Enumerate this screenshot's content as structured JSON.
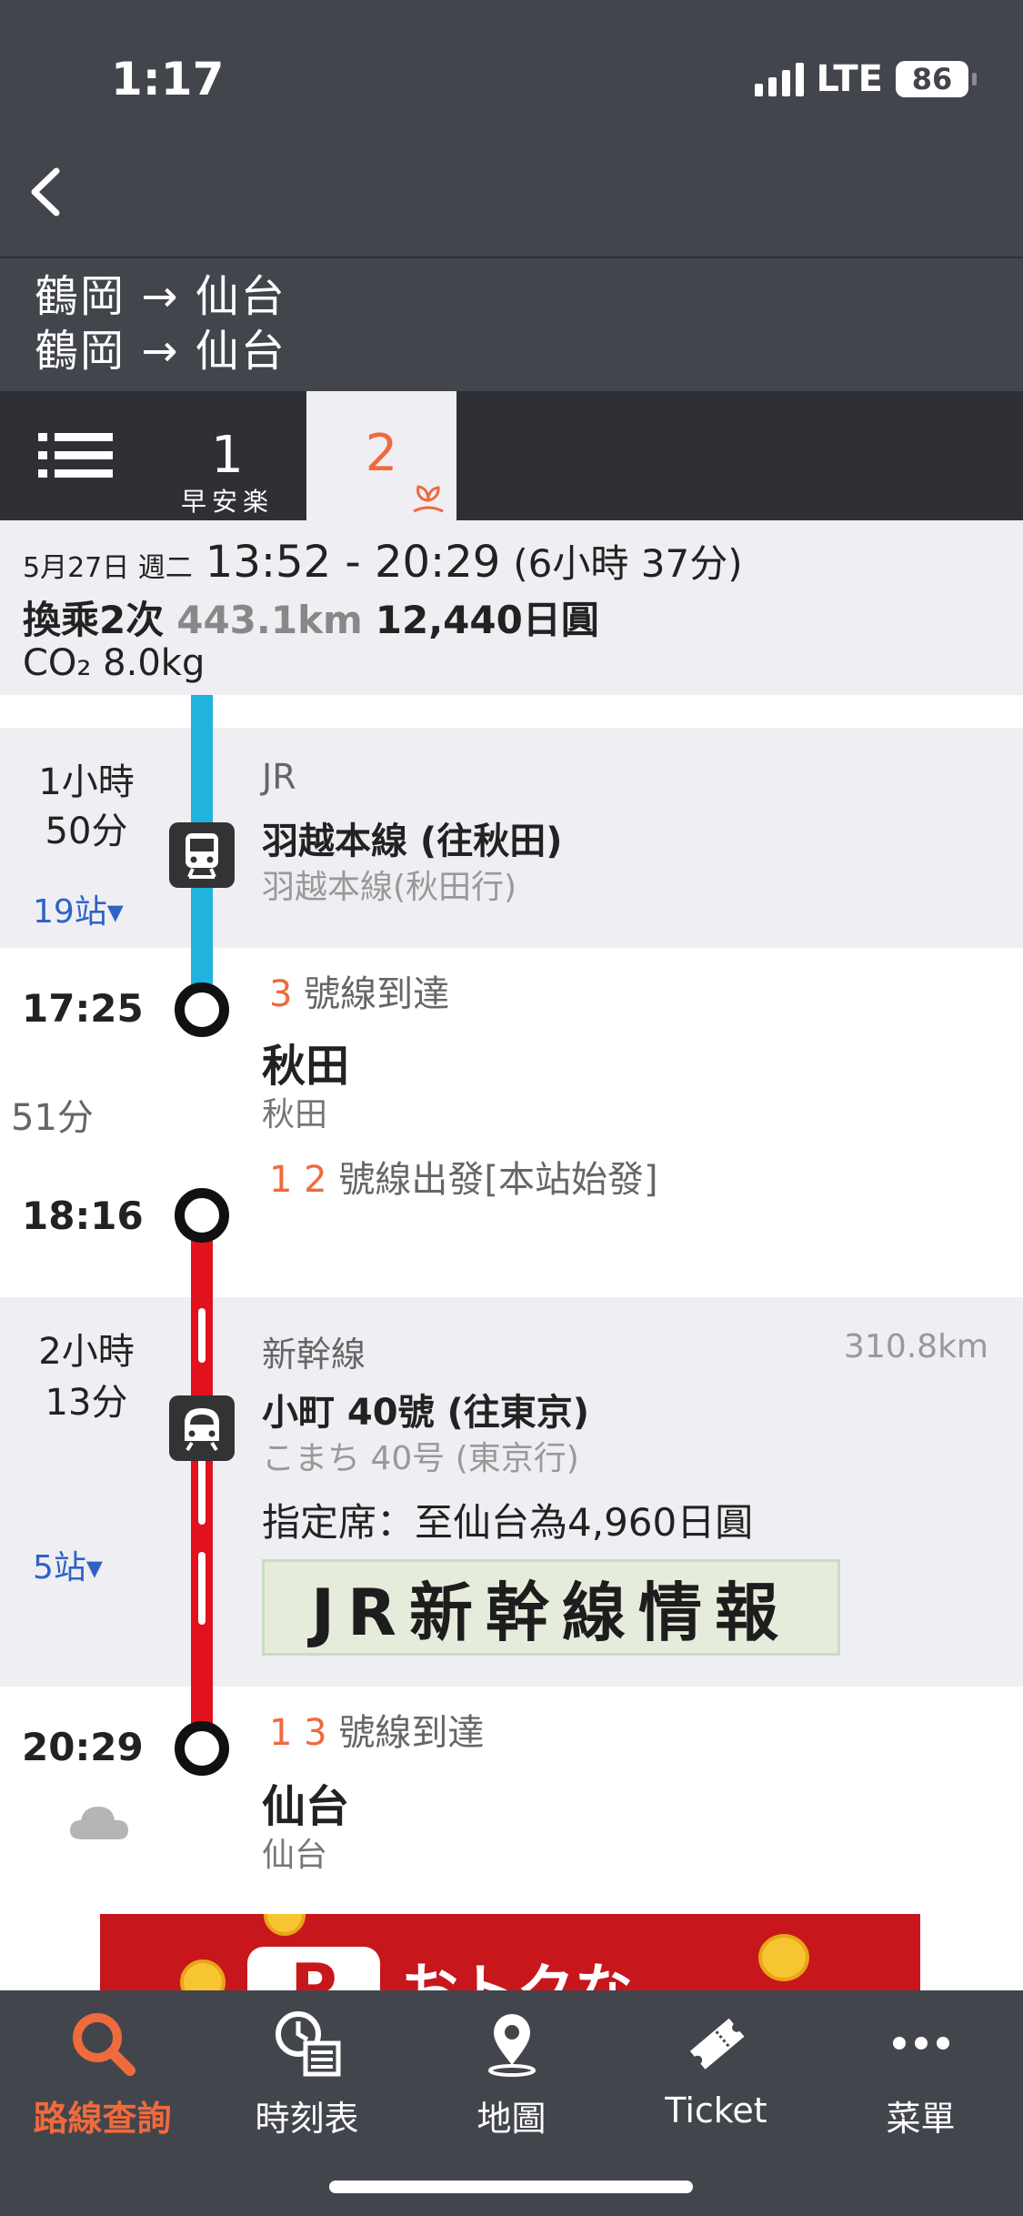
{
  "status": {
    "time": "1:17",
    "network": "LTE",
    "battery": "86"
  },
  "route": {
    "line1": "鶴岡 → 仙台",
    "line2": "鶴岡 → 仙台"
  },
  "tabs": [
    {
      "num": "1",
      "sub": "早安楽"
    },
    {
      "num": "2",
      "sub": ""
    }
  ],
  "summary": {
    "date": "5月27日 週二",
    "time": "13:52 - 20:29",
    "duration": "(6小時 37分)",
    "transfers": "換乘2次",
    "distance": "443.1km",
    "fare": "12,440日圓",
    "co2": "CO₂ 8.0kg"
  },
  "segment1": {
    "duration1": "1小時",
    "duration2": "50分",
    "stops": "19站▾",
    "company": "JR",
    "title": "羽越本線 (往秋田)",
    "sub": "羽越本線(秋田行)"
  },
  "transfer1": {
    "arr_time": "17:25",
    "arr_platform_num": "3",
    "arr_platform_text": "號線到達",
    "station": "秋田",
    "station_sub": "秋田",
    "wait": "51分",
    "dep_platform_num": "1 2",
    "dep_platform_text": "號線出發[本站始發]",
    "dep_time": "18:16"
  },
  "segment2": {
    "duration1": "2小時",
    "duration2": "13分",
    "stops": "5站▾",
    "company": "新幹線",
    "km": "310.8km",
    "title": "小町 40號 (往東京)",
    "sub": "こまち 40号 (東京行)",
    "seat": "指定席：至仙台為4,960日圓",
    "banner": "JR新幹線情報"
  },
  "arrival": {
    "time": "20:29",
    "platform_num": "1 3",
    "platform_text": "號線到達",
    "station": "仙台",
    "station_sub": "仙台"
  },
  "ad": {
    "p": "P",
    "text": "おトクな"
  },
  "bottom_nav": [
    {
      "label": "路線查詢",
      "icon": "search-icon"
    },
    {
      "label": "時刻表",
      "icon": "timetable-icon"
    },
    {
      "label": "地圖",
      "icon": "map-pin-icon"
    },
    {
      "label": "Ticket",
      "icon": "ticket-icon"
    },
    {
      "label": "菜單",
      "icon": "more-icon"
    }
  ],
  "colors": {
    "accent": "#ef6a3c",
    "blue_line": "#1fb3dd",
    "red_line": "#e1121e",
    "bar": "#43454c"
  }
}
